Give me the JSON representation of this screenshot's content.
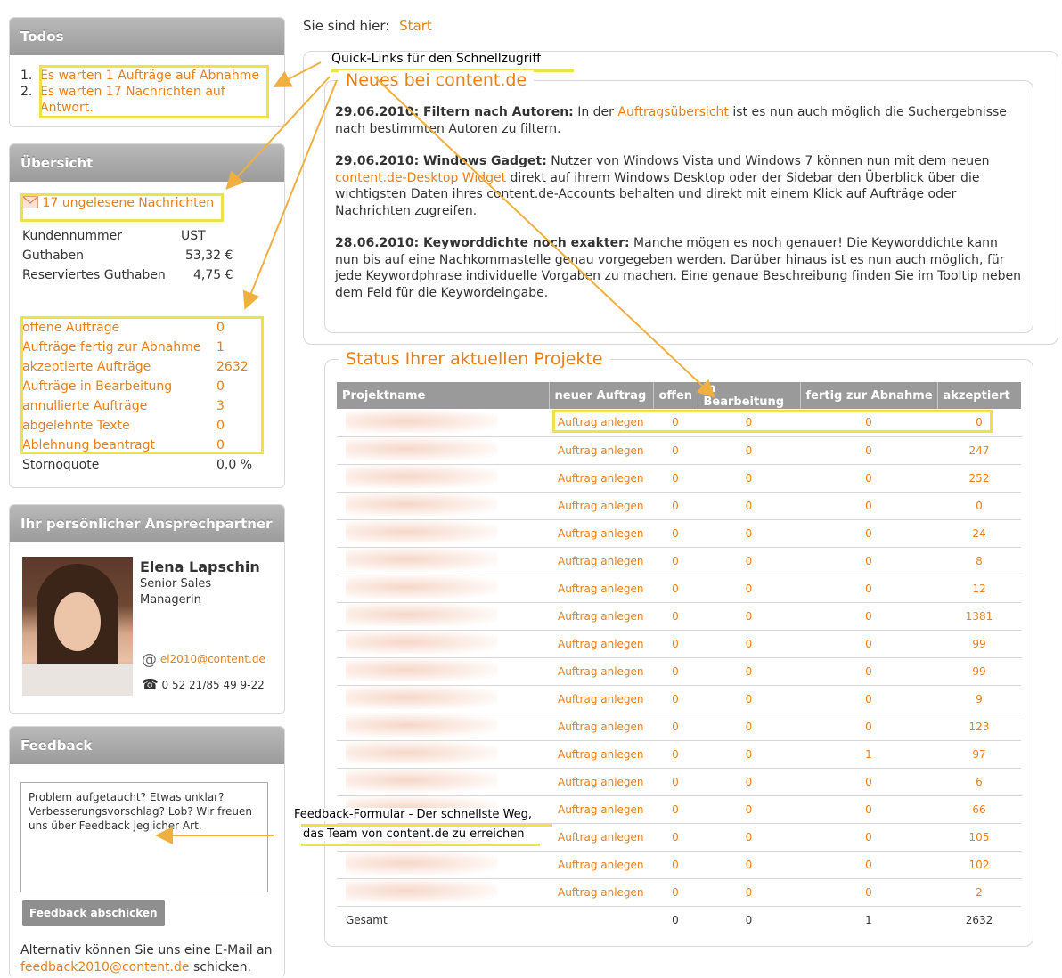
{
  "todos": {
    "title": "Todos",
    "items": [
      {
        "num": "1.",
        "text": "Es warten 1 Aufträge auf Abnahme"
      },
      {
        "num": "2.",
        "text": "Es warten 17 Nachrichten auf Antwort."
      }
    ]
  },
  "overview": {
    "title": "Übersicht",
    "messages": "17 ungelesene Nachrichten",
    "account": [
      {
        "label": "Kundennummer",
        "value": "UST"
      },
      {
        "label": "Guthaben",
        "value": "53,32 €"
      },
      {
        "label": "Reserviertes Guthaben",
        "value": "4,75 €"
      }
    ],
    "orders": [
      {
        "label": "offene Aufträge",
        "value": "0"
      },
      {
        "label": "Aufträge fertig zur Abnahme",
        "value": "1"
      },
      {
        "label": "akzeptierte Aufträge",
        "value": "2632"
      },
      {
        "label": "Aufträge in Bearbeitung",
        "value": "0"
      },
      {
        "label": "annullierte Aufträge",
        "value": "3"
      },
      {
        "label": "abgelehnte Texte",
        "value": "0"
      },
      {
        "label": "Ablehnung beantragt",
        "value": "0"
      }
    ],
    "storno": {
      "label": "Stornoquote",
      "value": "0,0 %"
    }
  },
  "contact": {
    "title": "Ihr persönlicher Ansprechpartner",
    "name": "Elena Lapschin",
    "role_line1": "Senior Sales",
    "role_line2": "Managerin",
    "email": "el2010@content.de",
    "phone": "0 52 21/85 49 9-22"
  },
  "feedback": {
    "title": "Feedback",
    "text": "Problem aufgetaucht? Etwas unklar? Verbesserungsvorschlag? Lob? Wir freuen uns über Feedback jeglicher Art.",
    "button": "Feedback abschicken",
    "alt_pre": "Alternativ können Sie uns eine E-Mail an",
    "alt_email": "feedback2010@content.de",
    "alt_post": "schicken."
  },
  "breadcrumb": {
    "label": "Sie sind hier:",
    "current": "Start"
  },
  "annotations": {
    "quicklinks": "Quick-Links für den Schnellzugriff",
    "feedback_line1": "Feedback-Formular - Der schnellste Weg,",
    "feedback_line2": "das Team von content.de zu erreichen"
  },
  "news": {
    "title": "Neues bei content.de",
    "items": [
      {
        "date": "29.06.2010: Filtern nach Autoren:",
        "t1": " In der ",
        "link": "Auftragsübersicht",
        "t2": " ist es nun auch möglich die Suchergebnisse nach bestimmten Autoren zu filtern."
      },
      {
        "date": "29.06.2010: Windows Gadget:",
        "t1": " Nutzer von Windows Vista und Windows 7 können nun mit dem neuen ",
        "link": "content.de-Desktop Widget",
        "t2": " direkt auf ihrem Windows Desktop oder der Sidebar den Überblick über die wichtigsten Daten ihres content.de-Accounts behalten und direkt mit einem Klick auf Aufträge oder Nachrichten zugreifen."
      },
      {
        "date": "28.06.2010: Keyworddichte noch exakter:",
        "t1": " Manche mögen es noch genauer! Die Keyworddichte kann nun bis auf eine Nachkommastelle genau vorgegeben werden. Darüber hinaus ist es nun auch möglich, für jede Keywordphrase individuelle Vorgaben zu machen. Eine genaue Beschreibung finden Sie im Tooltip neben dem Feld für die Keywordeingabe.",
        "link": "",
        "t2": ""
      }
    ]
  },
  "projects": {
    "title": "Status Ihrer aktuellen Projekte",
    "headers": [
      "Projektname",
      "neuer Auftrag",
      "offen",
      "in Bearbeitung",
      "fertig zur Abnahme",
      "akzeptiert"
    ],
    "action": "Auftrag anlegen",
    "rows": [
      {
        "offen": "0",
        "bearb": "0",
        "fertig": "0",
        "akz": "0"
      },
      {
        "offen": "0",
        "bearb": "0",
        "fertig": "0",
        "akz": "247"
      },
      {
        "offen": "0",
        "bearb": "0",
        "fertig": "0",
        "akz": "252"
      },
      {
        "offen": "0",
        "bearb": "0",
        "fertig": "0",
        "akz": "0"
      },
      {
        "offen": "0",
        "bearb": "0",
        "fertig": "0",
        "akz": "24"
      },
      {
        "offen": "0",
        "bearb": "0",
        "fertig": "0",
        "akz": "8"
      },
      {
        "offen": "0",
        "bearb": "0",
        "fertig": "0",
        "akz": "12"
      },
      {
        "offen": "0",
        "bearb": "0",
        "fertig": "0",
        "akz": "1381"
      },
      {
        "offen": "0",
        "bearb": "0",
        "fertig": "0",
        "akz": "99"
      },
      {
        "offen": "0",
        "bearb": "0",
        "fertig": "0",
        "akz": "99"
      },
      {
        "offen": "0",
        "bearb": "0",
        "fertig": "0",
        "akz": "9"
      },
      {
        "offen": "0",
        "bearb": "0",
        "fertig": "0",
        "akz": "123"
      },
      {
        "offen": "0",
        "bearb": "0",
        "fertig": "1",
        "akz": "97"
      },
      {
        "offen": "0",
        "bearb": "0",
        "fertig": "0",
        "akz": "6"
      },
      {
        "offen": "0",
        "bearb": "0",
        "fertig": "0",
        "akz": "66"
      },
      {
        "offen": "0",
        "bearb": "0",
        "fertig": "0",
        "akz": "105"
      },
      {
        "offen": "0",
        "bearb": "0",
        "fertig": "0",
        "akz": "102"
      },
      {
        "offen": "0",
        "bearb": "0",
        "fertig": "0",
        "akz": "2"
      }
    ],
    "total": {
      "label": "Gesamt",
      "offen": "0",
      "bearb": "0",
      "fertig": "1",
      "akz": "2632"
    }
  },
  "colors": {
    "accent": "#e8801a",
    "highlight": "#f0e04a",
    "header": "#9a9a9a"
  }
}
